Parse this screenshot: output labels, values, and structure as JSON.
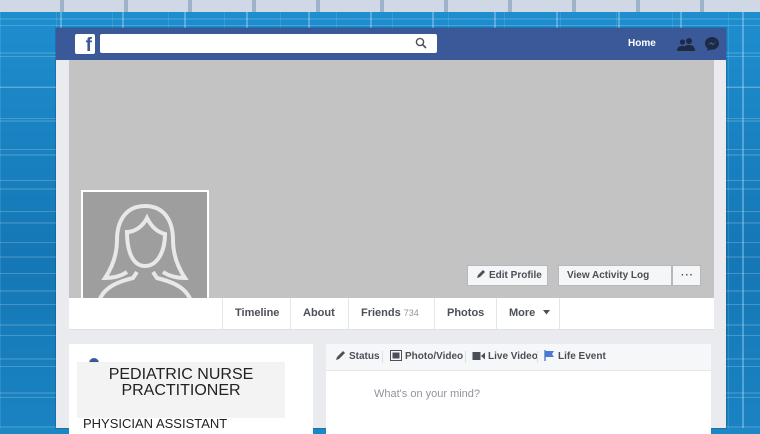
{
  "colors": {
    "facebook_blue": "#3b5998",
    "cover_gray": "#c3c3c3",
    "background_blue": "#1d86c4"
  },
  "navbar": {
    "logo_letter": "f",
    "search_icon": "search-icon",
    "home_label": "Home",
    "friends_icon": "friend-requests-icon",
    "messenger_icon": "messenger-icon"
  },
  "profile": {
    "avatar_icon": "default-female-avatar-icon",
    "edit_profile_label": "Edit Profile",
    "activity_log_label": "View Activity Log",
    "more_options_label": "···"
  },
  "tabs": [
    {
      "label": "Timeline"
    },
    {
      "label": "About"
    },
    {
      "label": "Friends",
      "count": "734"
    },
    {
      "label": "Photos"
    },
    {
      "label": "More"
    }
  ],
  "intro": {
    "title_line1": "PEDIATRIC NURSE",
    "title_line2": "PRACTITIONER",
    "subtitle": "PHYSICIAN ASSISTANT"
  },
  "composer": {
    "status_label": "Status",
    "photo_label": "Photo/Video",
    "live_label": "Live Video",
    "life_event_label": "Life Event",
    "placeholder": "What's on your mind?"
  }
}
